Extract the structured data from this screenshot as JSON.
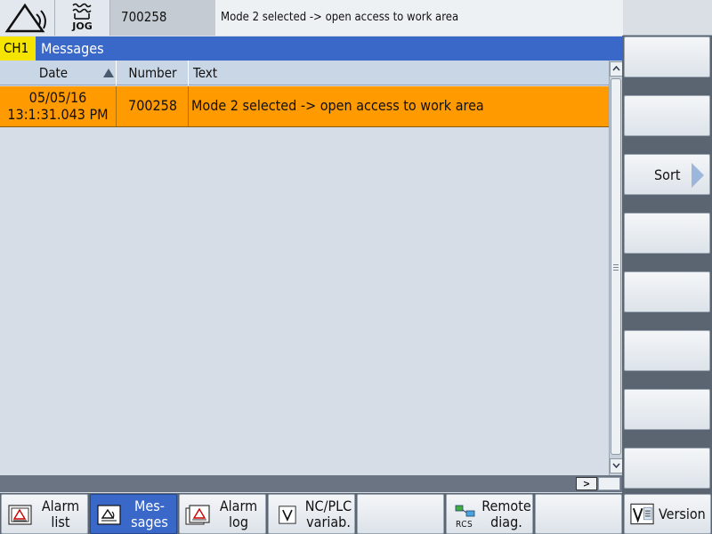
{
  "topbar": {
    "mode": "JOG",
    "alarm_number": "700258",
    "alarm_text": "Mode 2 selected -> open access to work area"
  },
  "titlebar": {
    "channel": "CH1",
    "title": "Messages"
  },
  "table": {
    "columns": [
      "Date",
      "Number",
      "Text"
    ],
    "sorted_column": "Date",
    "rows": [
      {
        "date": "05/05/16",
        "time": "13:1:31.043 PM",
        "number": "700258",
        "text": "Mode 2 selected -> open access to work area",
        "row_color": "#ff9a00"
      }
    ]
  },
  "hbar": {
    "scroll_right_label": ">"
  },
  "vertical_softkeys": [
    "",
    "",
    "Sort",
    "",
    "",
    "",
    "",
    ""
  ],
  "horizontal_softkeys": [
    {
      "line1": "Alarm",
      "line2": "list",
      "icon": "alarm-list-icon",
      "active": false
    },
    {
      "line1": "Mes-",
      "line2": "sages",
      "icon": "messages-icon",
      "active": true
    },
    {
      "line1": "Alarm",
      "line2": "log",
      "icon": "alarm-log-icon",
      "active": false
    },
    {
      "line1": "NC/PLC",
      "line2": "variab.",
      "icon": "variable-icon",
      "active": false
    },
    {
      "line1": "",
      "line2": "",
      "icon": "",
      "active": false
    },
    {
      "line1": "Remote",
      "line2": "diag.",
      "icon": "rcs-icon",
      "icon_text": "RCS",
      "active": false
    },
    {
      "line1": "",
      "line2": "",
      "icon": "",
      "active": false
    },
    {
      "line1": "Version",
      "line2": "",
      "icon": "version-icon",
      "active": false
    }
  ],
  "colors": {
    "accent": "#3a68c8",
    "channel_badge": "#f4e400",
    "message_row": "#ff9a00"
  }
}
